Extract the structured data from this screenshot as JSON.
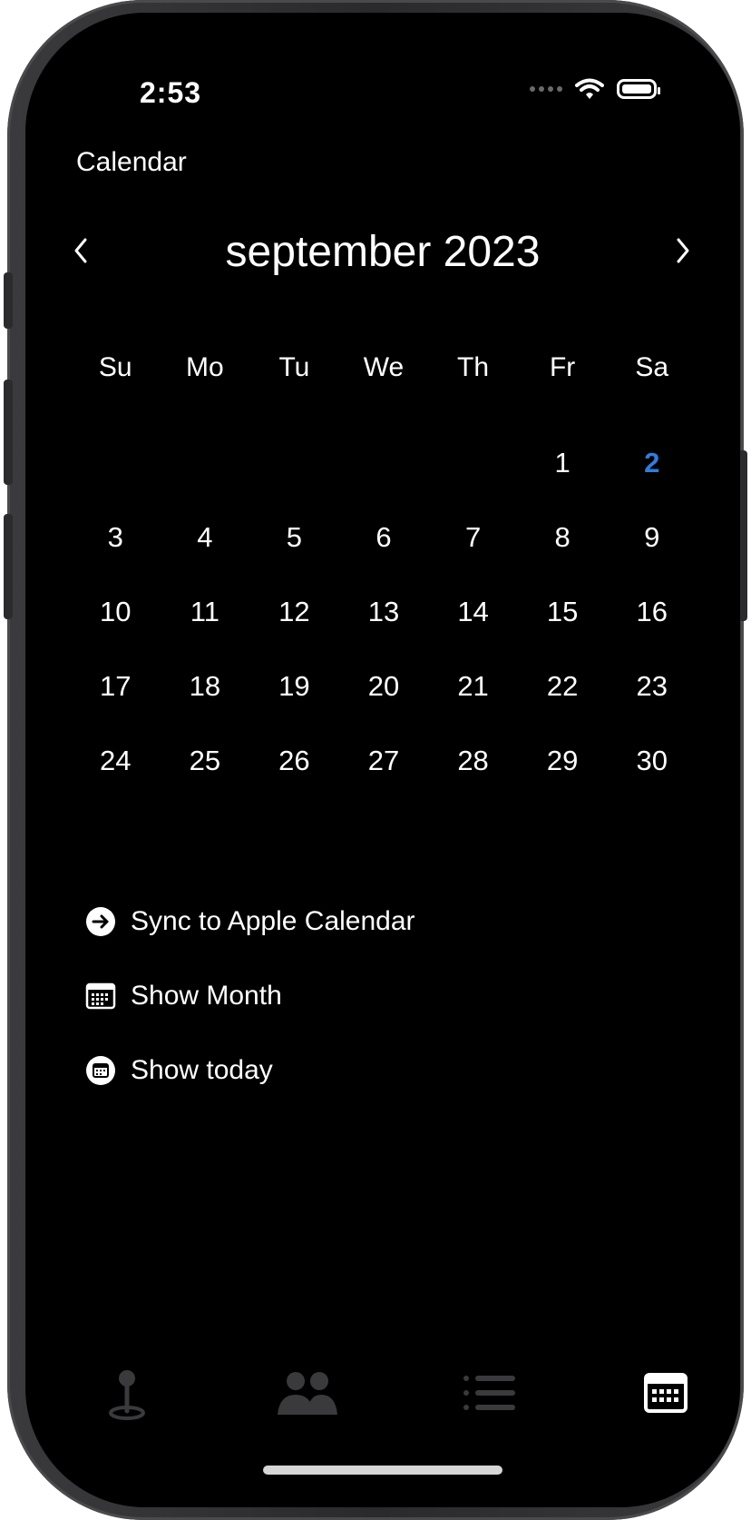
{
  "status": {
    "time": "2:53"
  },
  "nav": {
    "title": "Calendar"
  },
  "calendar": {
    "month_label": "september 2023",
    "weekdays": [
      "Su",
      "Mo",
      "Tu",
      "We",
      "Th",
      "Fr",
      "Sa"
    ],
    "weeks": [
      [
        "",
        "",
        "",
        "",
        "",
        "1",
        "2"
      ],
      [
        "3",
        "4",
        "5",
        "6",
        "7",
        "8",
        "9"
      ],
      [
        "10",
        "11",
        "12",
        "13",
        "14",
        "15",
        "16"
      ],
      [
        "17",
        "18",
        "19",
        "20",
        "21",
        "22",
        "23"
      ],
      [
        "24",
        "25",
        "26",
        "27",
        "28",
        "29",
        "30"
      ]
    ],
    "today": "2",
    "today_color": "#2f7ddf"
  },
  "actions": [
    {
      "label": "Sync to Apple Calendar",
      "icon": "arrow-right-circle-icon"
    },
    {
      "label": "Show Month",
      "icon": "calendar-grid-icon"
    },
    {
      "label": "Show today",
      "icon": "calendar-circle-icon"
    }
  ],
  "tabbar": {
    "tabs": [
      {
        "icon": "map-pin-icon",
        "active": false
      },
      {
        "icon": "people-icon",
        "active": false
      },
      {
        "icon": "list-icon",
        "active": false
      },
      {
        "icon": "calendar-icon",
        "active": true
      }
    ],
    "active_color": "#ffffff",
    "inactive_color": "#3a3a3c"
  }
}
